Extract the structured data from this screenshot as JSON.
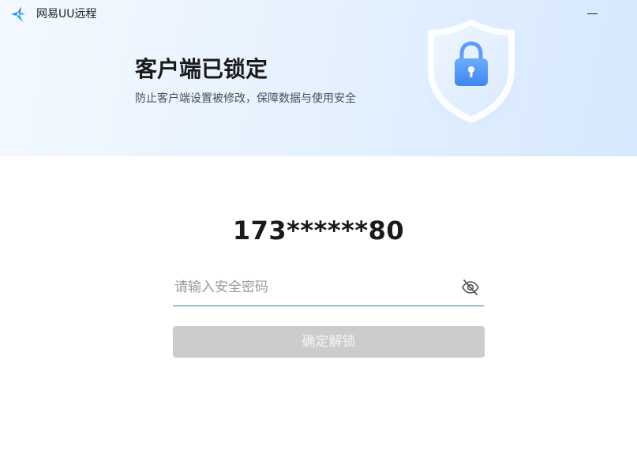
{
  "window": {
    "app_name": "网易UU远程",
    "icons": {
      "logo": "netease-uu-logo-icon",
      "minimize": "minimize-icon",
      "shield": "shield-lock-icon",
      "eye": "eye-off-icon"
    }
  },
  "lock_banner": {
    "title": "客户端已锁定",
    "subtitle": "防止客户端设置被修改，保障数据与使用安全"
  },
  "unlock_form": {
    "account": "173******80",
    "password": {
      "value": "",
      "placeholder": "请输入安全密码"
    },
    "submit_label": "确定解锁",
    "submit_enabled": false
  },
  "colors": {
    "accent_underline": "#2f7d8a",
    "button_disabled": "#cccccc",
    "shield_blue": "#4d94f7",
    "banner_light": "#f3f9ff",
    "banner_blue": "#d6e8fd"
  }
}
